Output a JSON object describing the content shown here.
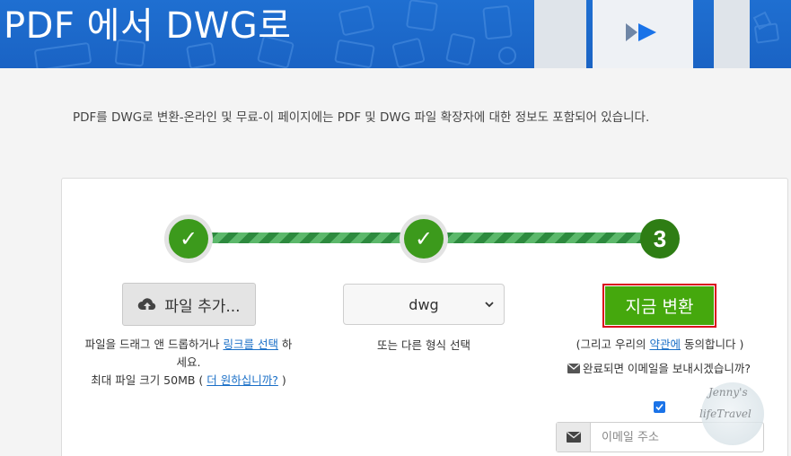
{
  "header": {
    "title": "PDF 에서 DWG로"
  },
  "intro": {
    "text": "PDF를 DWG로 변환-온라인 및 무료-이 페이지에는 PDF 및 DWG 파일 확장자에 대한 정보도 포함되어 있습니다."
  },
  "stepper": {
    "step1": "✓",
    "step2": "✓",
    "step3": "3"
  },
  "upload": {
    "button_label": "파일 추가...",
    "drag_text_1": "파일을 드래그 앤 드롭하거나 ",
    "link_text": "링크를 선택",
    "drag_text_2": " 하세요.",
    "max_size_text": "최대 파일 크기 50MB ( ",
    "more_link": "더 원하십니까?",
    "max_size_close": " )"
  },
  "format": {
    "selected": "dwg",
    "caption": "또는 다른 형식 선택"
  },
  "convert": {
    "button_label": "지금 변환",
    "terms_prefix": "(그리고 우리의 ",
    "terms_link": "약관에",
    "terms_suffix": " 동의합니다 )",
    "email_question": "완료되면 이메일을 보내시겠습니까?",
    "email_placeholder": "이메일 주소"
  },
  "watermark": {
    "line1": "Jenny's",
    "line2": "lifeTravel"
  },
  "colors": {
    "banner": "#1f6fd1",
    "step_green": "#3c9a1c",
    "convert_green": "#45a80d",
    "highlight_red": "#d9001b",
    "link_blue": "#1a6fc7"
  }
}
